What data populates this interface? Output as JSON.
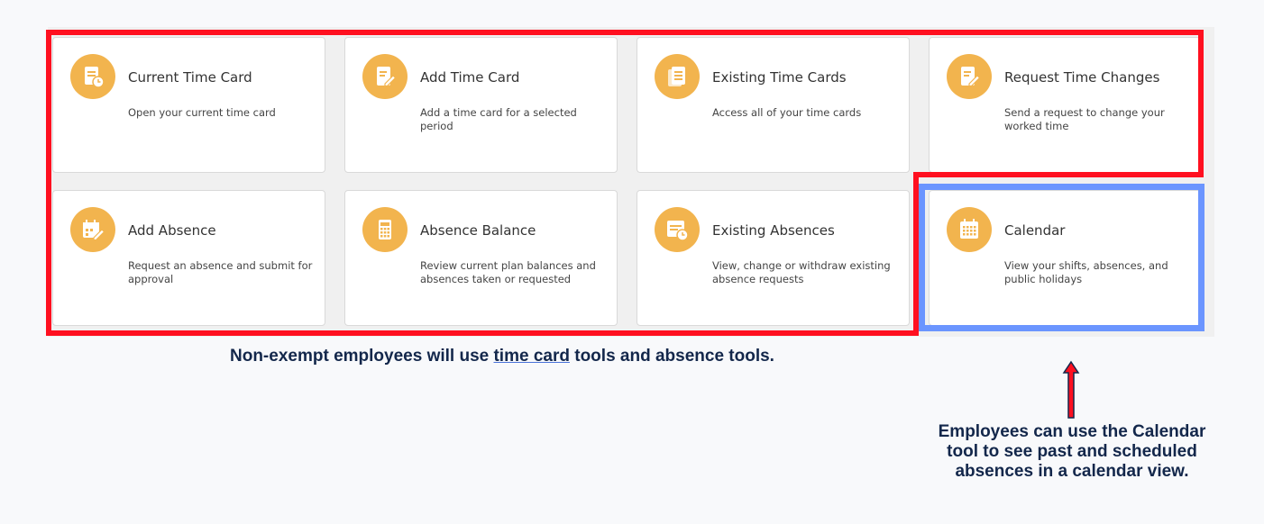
{
  "tiles": [
    {
      "title": "Current Time Card",
      "desc": "Open your current time card",
      "icon": "time-card-clock-icon"
    },
    {
      "title": "Add Time Card",
      "desc": "Add a time card for a selected period",
      "icon": "edit-document-icon"
    },
    {
      "title": "Existing Time Cards",
      "desc": "Access all of your time cards",
      "icon": "stacked-documents-icon"
    },
    {
      "title": "Request Time Changes",
      "desc": "Send a request to change your worked time",
      "icon": "edit-document-icon"
    },
    {
      "title": "Add Absence",
      "desc": "Request an absence and submit for approval",
      "icon": "calendar-edit-icon"
    },
    {
      "title": "Absence Balance",
      "desc": "Review current plan balances and absences taken or requested",
      "icon": "calculator-icon"
    },
    {
      "title": "Existing Absences",
      "desc": "View, change or withdraw existing absence requests",
      "icon": "calendar-clock-icon"
    },
    {
      "title": "Calendar",
      "desc": "View your shifts, absences, and public holidays",
      "icon": "calendar-icon"
    }
  ],
  "caption": {
    "before": "Non-exempt employees will use ",
    "link": "time card",
    "after": " tools and absence tools."
  },
  "note": "Employees can use the Calendar tool to see past and scheduled absences in a calendar view.",
  "colors": {
    "icon_bg": "#f2b44e",
    "highlight_red": "#ff1020",
    "highlight_blue": "#6b95ff",
    "text_dark": "#13274b"
  }
}
